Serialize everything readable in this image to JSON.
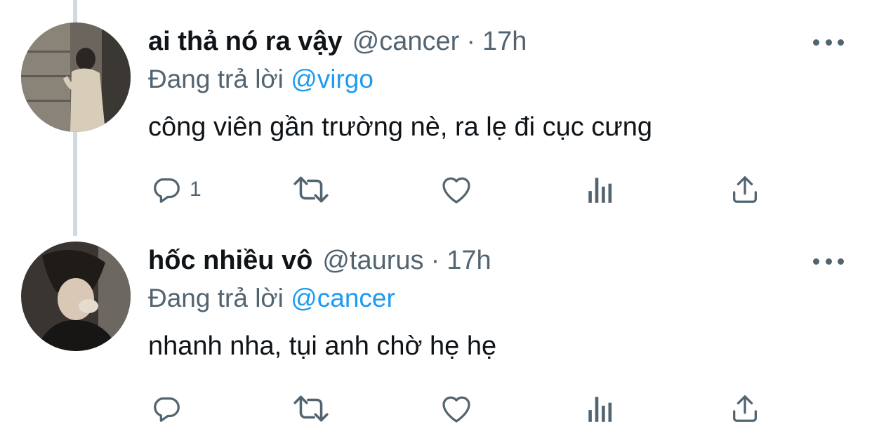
{
  "tweets": [
    {
      "name": "ai thả nó ra vậy",
      "handle": "@cancer",
      "separator": "·",
      "time": "17h",
      "reply_prefix": "Đang trả lời",
      "reply_to": "@virgo",
      "text": "công viên gần trường nè, ra lẹ đi cục cưng",
      "reply_count": "1"
    },
    {
      "name": "hốc nhiều vô",
      "handle": "@taurus",
      "separator": "·",
      "time": "17h",
      "reply_prefix": "Đang trả lời",
      "reply_to": "@cancer",
      "text": "nhanh nha, tụi anh chờ hẹ hẹ",
      "reply_count": ""
    }
  ],
  "icons": [
    "reply-icon",
    "retweet-icon",
    "like-icon",
    "analytics-icon",
    "share-icon",
    "more-icon"
  ],
  "colors": {
    "text": "#0f1419",
    "secondary": "#536471",
    "link": "#1d9bf0",
    "thread_line": "#cfd9de"
  }
}
